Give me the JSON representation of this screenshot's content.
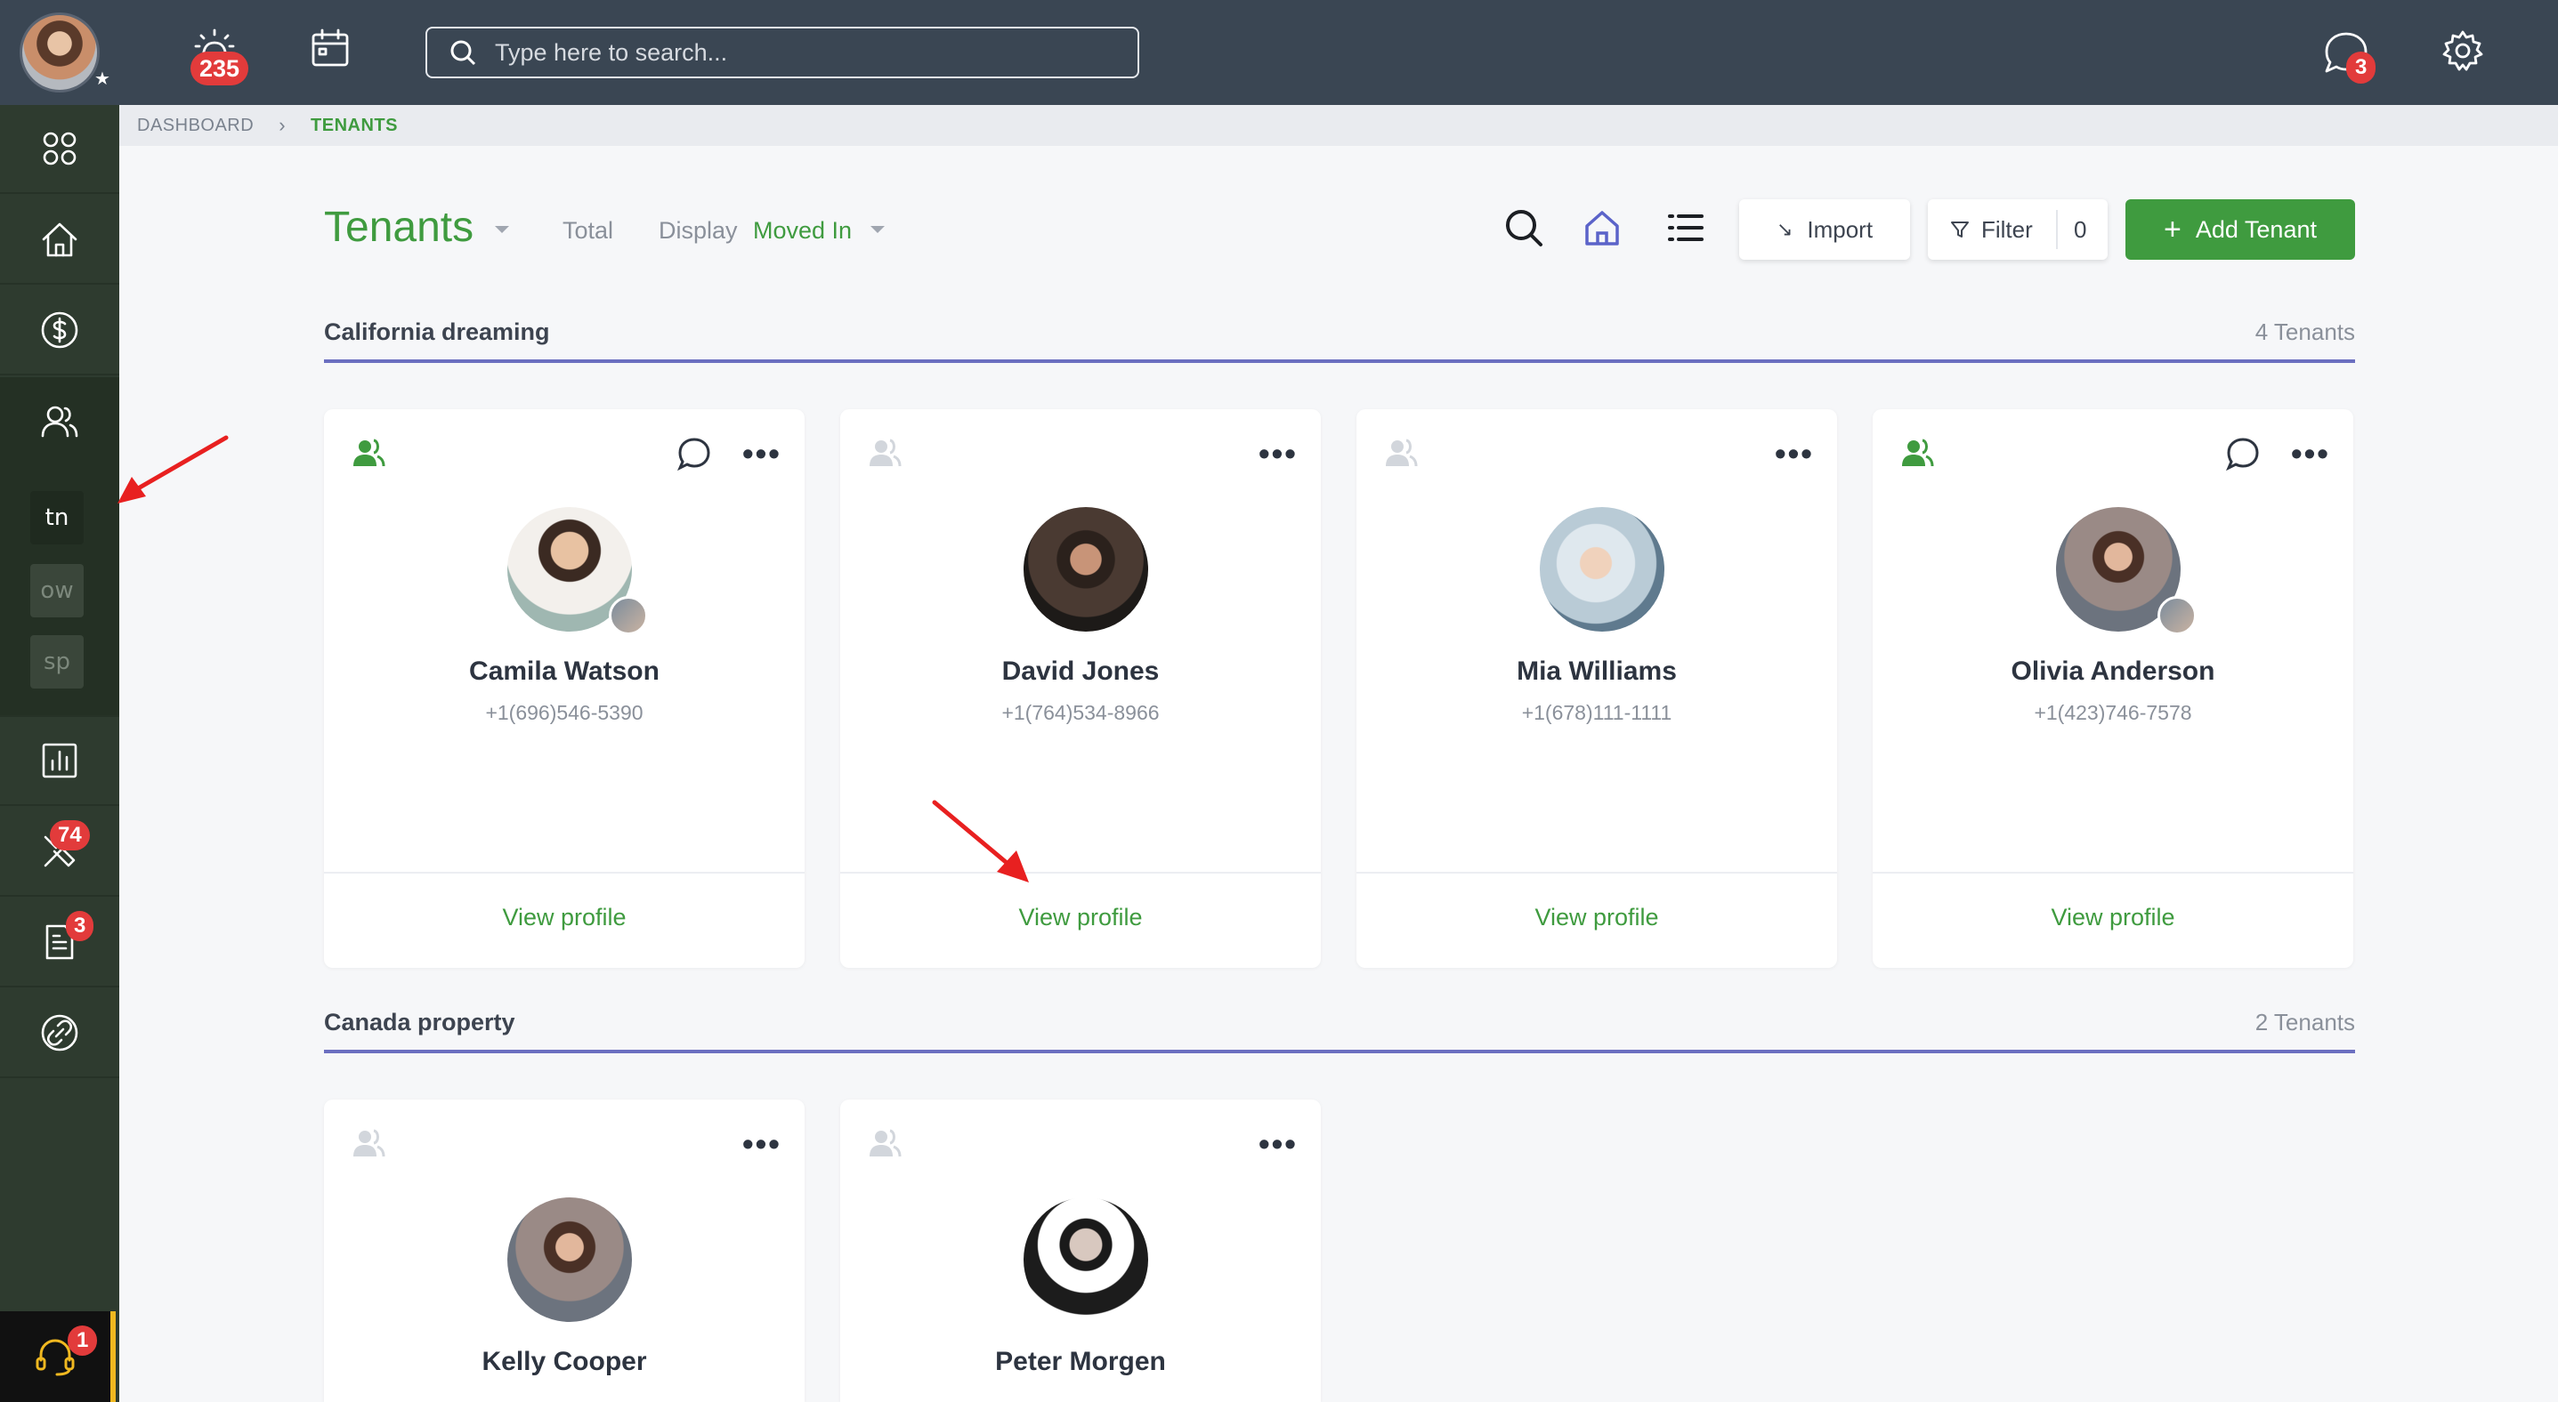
{
  "topbar": {
    "alerts_badge": "235",
    "search_placeholder": "Type here to search...",
    "chat_badge": "3"
  },
  "sidebar": {
    "sub_items": [
      "tn",
      "ow",
      "sp"
    ],
    "maintenance_badge": "74",
    "documents_badge": "3",
    "support_badge": "1"
  },
  "breadcrumb": {
    "home": "DASHBOARD",
    "current": "TENANTS"
  },
  "header": {
    "title": "Tenants",
    "total_label": "Total",
    "display_label": "Display",
    "display_value": "Moved In",
    "import_label": "Import",
    "filter_label": "Filter",
    "filter_count": "0",
    "add_label": "Add Tenant"
  },
  "colors": {
    "accent_green": "#3f9b3f",
    "section_line": "#6b6fc0",
    "badge_red": "#e23b3b"
  },
  "sections": [
    {
      "title": "California dreaming",
      "count": "4 Tenants",
      "tenants": [
        {
          "name": "Camila Watson",
          "phone": "+1(696)546-5390",
          "view": "View profile"
        },
        {
          "name": "David Jones",
          "phone": "+1(764)534-8966",
          "view": "View profile"
        },
        {
          "name": "Mia Williams",
          "phone": "+1(678)111-1111",
          "view": "View profile"
        },
        {
          "name": "Olivia Anderson",
          "phone": "+1(423)746-7578",
          "view": "View profile"
        }
      ]
    },
    {
      "title": "Canada property",
      "count": "2 Tenants",
      "tenants": [
        {
          "name": "Kelly Cooper"
        },
        {
          "name": "Peter Morgen"
        }
      ]
    }
  ]
}
